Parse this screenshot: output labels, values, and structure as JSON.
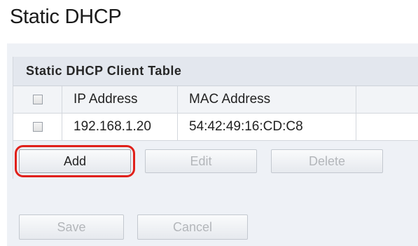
{
  "page": {
    "title": "Static DHCP"
  },
  "table": {
    "caption": "Static DHCP Client Table",
    "columns": [
      "IP Address",
      "MAC Address"
    ],
    "rows": [
      {
        "ip": "192.168.1.20",
        "mac": "54:42:49:16:CD:C8",
        "checked": false
      }
    ]
  },
  "table_buttons": {
    "add": "Add",
    "edit": "Edit",
    "delete": "Delete"
  },
  "form_buttons": {
    "save": "Save",
    "cancel": "Cancel"
  },
  "colors": {
    "highlight": "#e0201a",
    "panel_bg": "#eef1f6"
  }
}
